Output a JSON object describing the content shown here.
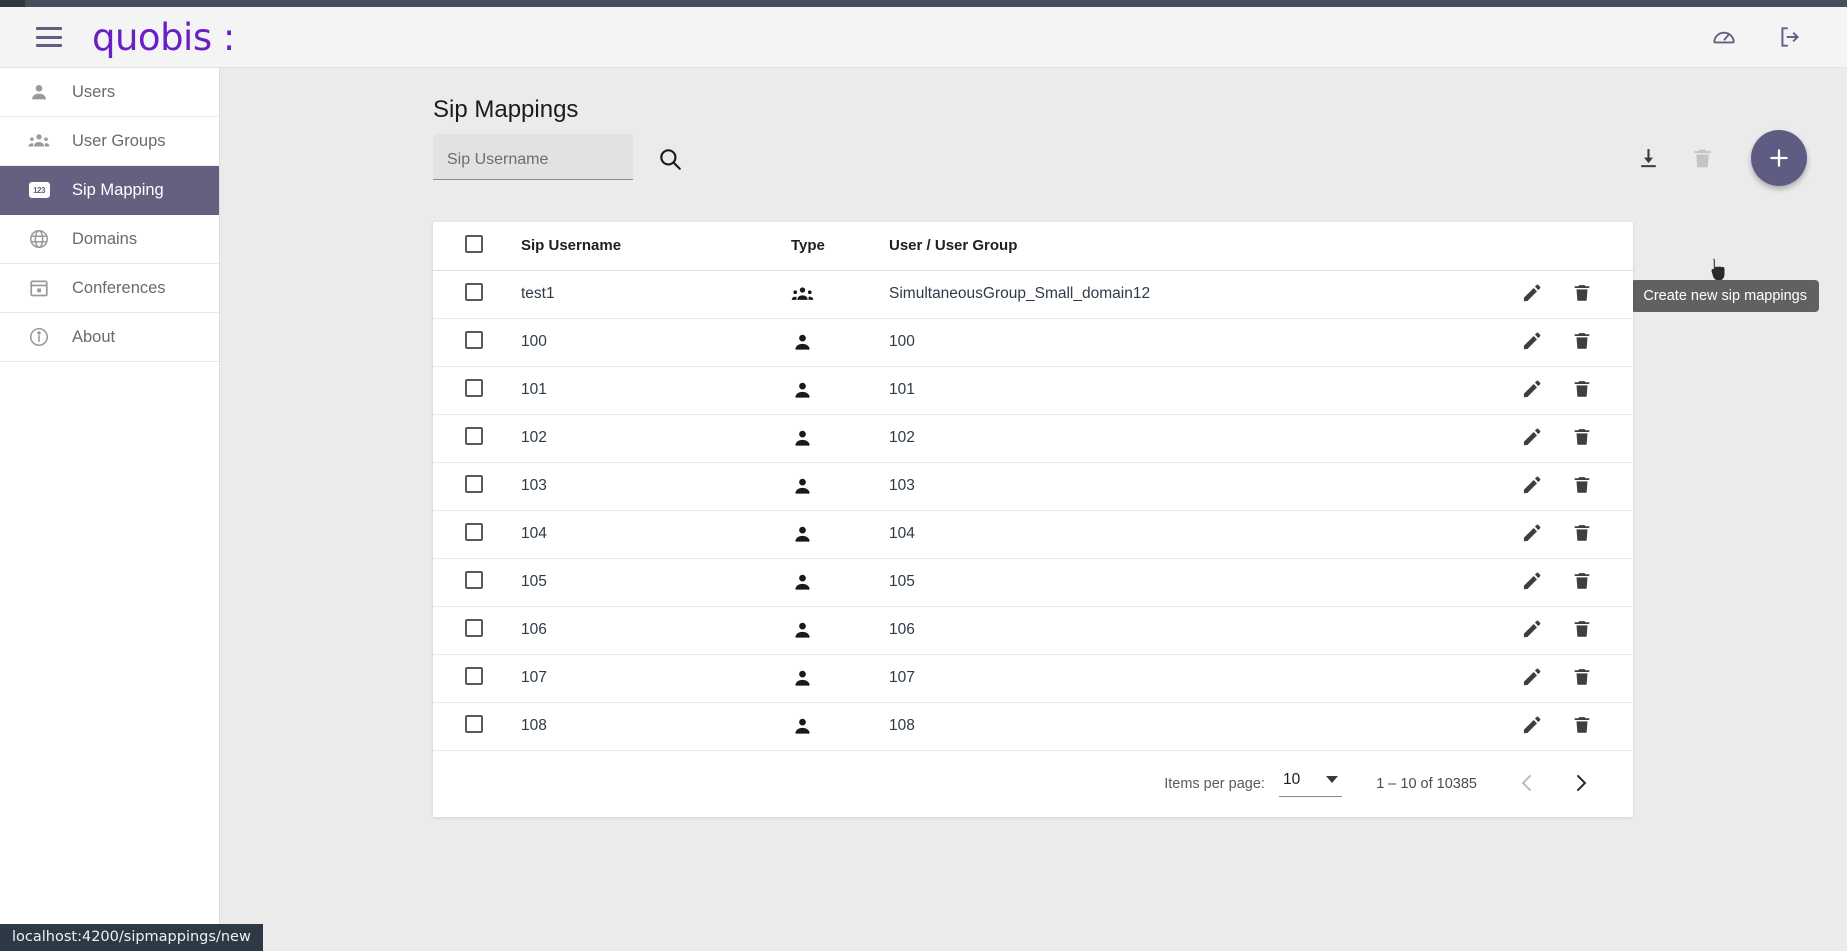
{
  "header": {
    "menu_icon": "hamburger-icon",
    "logo_text": "quobis :",
    "icons": [
      {
        "name": "dashboard-icon",
        "label": "Dashboard"
      },
      {
        "name": "logout-icon",
        "label": "Logout"
      }
    ]
  },
  "sidebar": {
    "items": [
      {
        "label": "Users",
        "icon": "person-icon",
        "active": false
      },
      {
        "label": "User Groups",
        "icon": "group-icon",
        "active": false
      },
      {
        "label": "Sip Mapping",
        "icon": "123-icon",
        "active": true
      },
      {
        "label": "Domains",
        "icon": "globe-icon",
        "active": false
      },
      {
        "label": "Conferences",
        "icon": "calendar-icon",
        "active": false
      },
      {
        "label": "About",
        "icon": "info-icon",
        "active": false
      }
    ]
  },
  "main": {
    "page_title": "Sip Mappings",
    "search": {
      "placeholder": "Sip Username",
      "value": "",
      "search_icon": "search-icon"
    },
    "actions": {
      "download_label": "Download",
      "delete_label": "Delete",
      "create_label": "Create new sip mappings",
      "fab_symbol": "+"
    },
    "tooltip": "Create new sip mappings",
    "table": {
      "columns": [
        "Sip Username",
        "Type",
        "User / User Group"
      ],
      "rows": [
        {
          "sip_username": "test1",
          "type": "group",
          "user_group": "SimultaneousGroup_Small_domain12"
        },
        {
          "sip_username": "100",
          "type": "user",
          "user_group": "100"
        },
        {
          "sip_username": "101",
          "type": "user",
          "user_group": "101"
        },
        {
          "sip_username": "102",
          "type": "user",
          "user_group": "102"
        },
        {
          "sip_username": "103",
          "type": "user",
          "user_group": "103"
        },
        {
          "sip_username": "104",
          "type": "user",
          "user_group": "104"
        },
        {
          "sip_username": "105",
          "type": "user",
          "user_group": "105"
        },
        {
          "sip_username": "106",
          "type": "user",
          "user_group": "106"
        },
        {
          "sip_username": "107",
          "type": "user",
          "user_group": "107"
        },
        {
          "sip_username": "108",
          "type": "user",
          "user_group": "108"
        }
      ]
    },
    "paginator": {
      "items_per_page_label": "Items per page:",
      "items_per_page_value": "10",
      "range_label": "1 – 10 of 10385",
      "prev_label": "Previous page",
      "next_label": "Next page"
    }
  },
  "statusbar": {
    "url": "localhost:4200/sipmappings/new"
  },
  "colors": {
    "brand_purple": "#6a1fc4",
    "accent": "#5f5c84",
    "sidebar_active": "#646180",
    "header_bg": "#f4f4f4",
    "page_bg": "#ebebeb",
    "tooltip_bg": "#616161",
    "statusbar_bg": "#2d3a45"
  }
}
